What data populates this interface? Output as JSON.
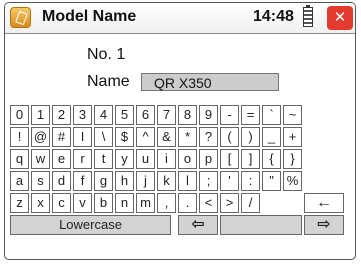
{
  "title": "Model Name",
  "clock": "14:48",
  "number_label": "No.",
  "number_value": "1",
  "name_label": "Name",
  "name_value": "QR X350",
  "icons": {
    "app": "model-name-app-icon",
    "battery": "battery-icon",
    "exit": "exit-run-icon"
  },
  "keyboard_rows": [
    [
      "0",
      "1",
      "2",
      "3",
      "4",
      "5",
      "6",
      "7",
      "8",
      "9",
      "-",
      "=",
      "`",
      "~"
    ],
    [
      "!",
      "@",
      "#",
      "I",
      "\\",
      "$",
      "^",
      "&",
      "*",
      "?",
      "(",
      ")",
      "_",
      "+"
    ],
    [
      "q",
      "w",
      "e",
      "r",
      "t",
      "y",
      "u",
      "i",
      "o",
      "p",
      "[",
      "]",
      "{",
      "}"
    ],
    [
      "a",
      "s",
      "d",
      "f",
      "g",
      "h",
      "j",
      "k",
      "l",
      ";",
      "'",
      ":",
      "\"",
      "%"
    ],
    [
      "z",
      "x",
      "c",
      "v",
      "b",
      "n",
      "m",
      ",",
      ".",
      "<",
      ">",
      "/",
      "←"
    ]
  ],
  "bottom_row": {
    "lowercase": "Lowercase",
    "left_arrow": "⇦",
    "right_arrow": "⇨"
  },
  "colors": {
    "exit_icon": "#e53a2e",
    "bottom_keys": "#d3d3d3",
    "field_bg": "#cccccc"
  }
}
